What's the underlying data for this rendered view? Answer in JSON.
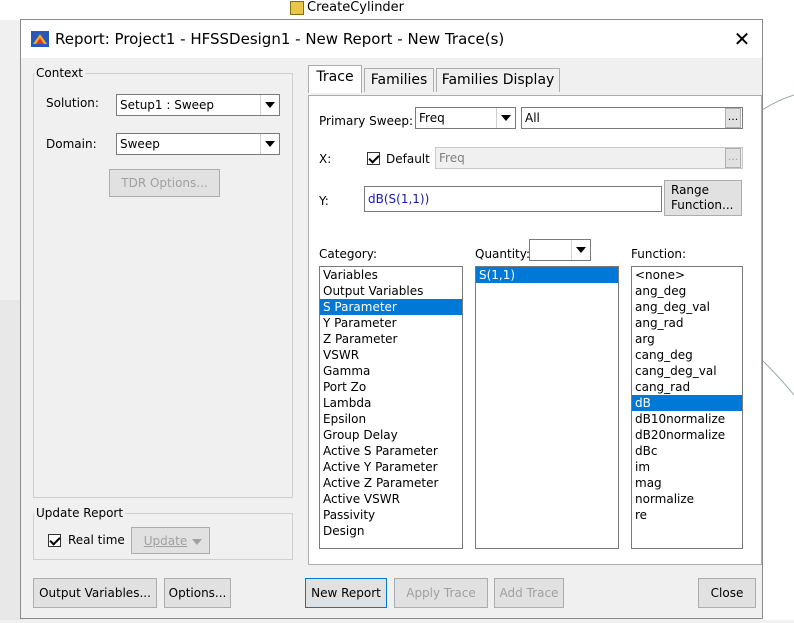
{
  "background": {
    "tree_item": "CreateCylinder"
  },
  "dialog": {
    "title": "Report: Project1 - HFSSDesign1 - New Report - New Trace(s)",
    "close_glyph": "✕"
  },
  "context": {
    "legend": "Context",
    "solution_label": "Solution:",
    "solution_value": "Setup1 : Sweep",
    "domain_label": "Domain:",
    "domain_value": "Sweep",
    "tdr_button": "TDR Options..."
  },
  "update_report": {
    "legend": "Update Report",
    "realtime_label": "Real time",
    "realtime_checked": true,
    "update_button": "Update"
  },
  "tabs": [
    {
      "label": "Trace",
      "active": true
    },
    {
      "label": "Families",
      "active": false
    },
    {
      "label": "Families Display",
      "active": false
    }
  ],
  "trace": {
    "primary_sweep_label": "Primary Sweep:",
    "primary_sweep_value": "Freq",
    "primary_sweep_range": "All",
    "x_label": "X:",
    "default_label": "Default",
    "default_checked": true,
    "x_value": "Freq",
    "y_label": "Y:",
    "y_value": "dB(S(1,1))",
    "range_function_button": "Range\nFunction...",
    "range_line1": "Range",
    "range_line2": "Function...",
    "ellipsis": "..."
  },
  "lists": {
    "category_label": "Category:",
    "quantity_label": "Quantity:",
    "function_label": "Function:",
    "categories": [
      "Variables",
      "Output Variables",
      "S Parameter",
      "Y Parameter",
      "Z Parameter",
      "VSWR",
      "Gamma",
      "Port Zo",
      "Lambda",
      "Epsilon",
      "Group Delay",
      "Active S Parameter",
      "Active Y Parameter",
      "Active Z Parameter",
      "Active VSWR",
      "Passivity",
      "Design"
    ],
    "category_selected": "S Parameter",
    "quantities": [
      "S(1,1)"
    ],
    "quantity_selected": "S(1,1)",
    "functions": [
      "<none>",
      "ang_deg",
      "ang_deg_val",
      "ang_rad",
      "arg",
      "cang_deg",
      "cang_deg_val",
      "cang_rad",
      "dB",
      "dB10normalize",
      "dB20normalize",
      "dBc",
      "im",
      "mag",
      "normalize",
      "re"
    ],
    "function_selected": "dB"
  },
  "footer": {
    "output_variables": "Output Variables...",
    "options": "Options...",
    "new_report": "New Report",
    "apply_trace": "Apply Trace",
    "add_trace": "Add Trace",
    "close": "Close"
  },
  "colors": {
    "selection": "#0078d7",
    "dialog_bg": "#f0f0f0"
  }
}
